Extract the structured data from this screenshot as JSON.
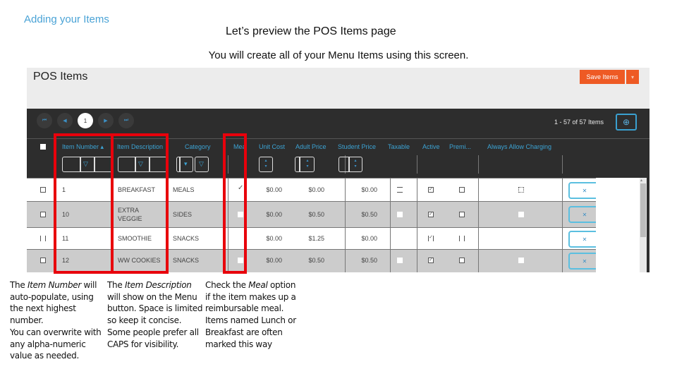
{
  "slide": {
    "title": "Adding your Items",
    "heading": "Let’s preview the POS Items page",
    "subheading": "You will create all of your Menu Items using this screen."
  },
  "pos": {
    "title": "POS Items",
    "save_button": "Save Items",
    "save_menu_icon": "caret-down-icon",
    "pager": {
      "first": "⏮",
      "prev": "◀",
      "current_page": "1",
      "next": "▶",
      "last": "⏭"
    },
    "count_text": "1 - 57 of 57 Items",
    "add_icon": "⊕",
    "columns": [
      "Item Number ▴",
      "Item Description",
      "Category",
      "Meal",
      "Unit Cost",
      "Adult Price",
      "Student Price",
      "Taxable",
      "Active",
      "Premi...",
      "Always Allow Charging"
    ],
    "sort_indicator": "ascending on Item Number",
    "filter_icon": "▽",
    "dropdown_icon": "▾",
    "spin_up": "▴",
    "spin_down": "▾",
    "rows": [
      {
        "number": "1",
        "description": "BREAKFAST",
        "category": "MEALS",
        "meal": true,
        "unit_cost": "$0.00",
        "adult_price": "$0.00",
        "student_price": "$0.00",
        "taxable": false,
        "active": true,
        "premium": false,
        "always_allow_charging": false,
        "delete": "✕"
      },
      {
        "number": "10",
        "description": "EXTRA VEGGIE",
        "category": "SIDES",
        "meal": false,
        "unit_cost": "$0.00",
        "adult_price": "$0.50",
        "student_price": "$0.50",
        "taxable": false,
        "active": true,
        "premium": false,
        "always_allow_charging": false,
        "delete": "✕"
      },
      {
        "number": "11",
        "description": "SMOOTHIE",
        "category": "SNACKS",
        "meal": false,
        "unit_cost": "$0.00",
        "adult_price": "$1.25",
        "student_price": "$0.00",
        "taxable": false,
        "active": true,
        "premium": false,
        "always_allow_charging": false,
        "delete": "✕"
      },
      {
        "number": "12",
        "description": "WW COOKIES",
        "category": "SNACKS",
        "meal": false,
        "unit_cost": "$0.00",
        "adult_price": "$0.50",
        "student_price": "$0.50",
        "taxable": false,
        "active": true,
        "premium": false,
        "always_allow_charging": false,
        "delete": "✕"
      }
    ],
    "check_mark": "✓",
    "highlight_color": "#e8000b",
    "accent_color": "#ee5a24",
    "link_color": "#3ca3d4"
  },
  "notes": {
    "item_number": {
      "pre": "The ",
      "em": "Item Number",
      "post": " will auto-populate, using the next highest number.",
      "line2": "You can overwrite with any alpha-numeric value as needed."
    },
    "item_description": {
      "pre": "The ",
      "em": "Item Description",
      "post": " will show on the Menu button. Space is limited so keep it concise.",
      "line2": "Some people prefer all CAPS for visibility."
    },
    "meal": {
      "pre": "Check the ",
      "em": "Meal",
      "post": " option if the item makes up a reimbursable meal. Items named Lunch or Breakfast are often marked this way"
    }
  }
}
